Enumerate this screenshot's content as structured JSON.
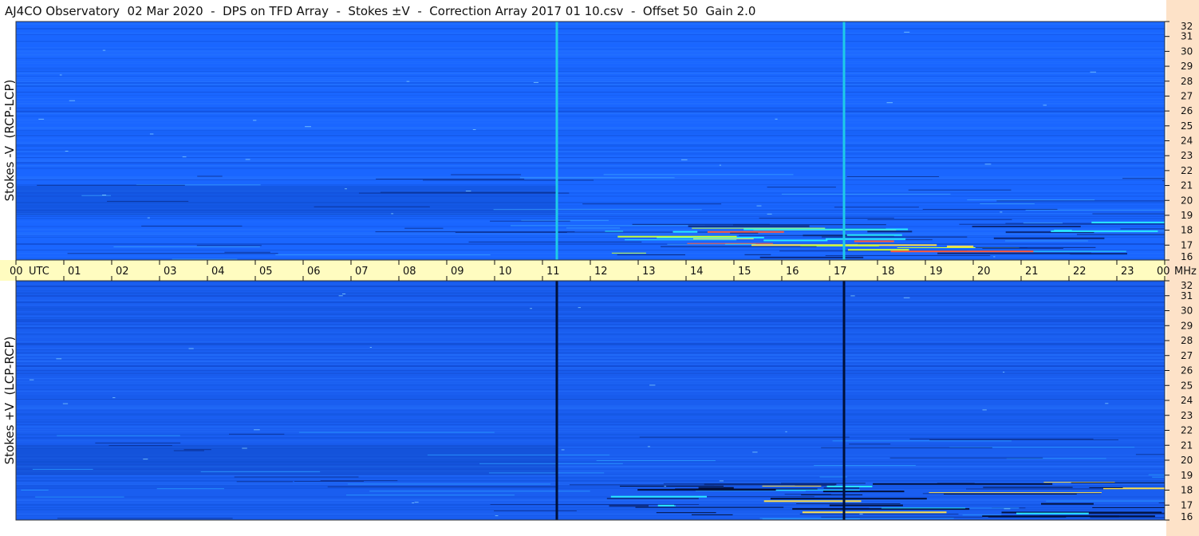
{
  "title": "AJ4CO Observatory  02 Mar 2020  -  DPS on TFD Array  -  Stokes ±V  -  Correction Array 2017 01 10.csv  -  Offset 50  Gain 2.0",
  "colors": {
    "background_top": "#1a66ff",
    "background_bottom": "#1a5ef0",
    "utc_bar": "#fffcc0",
    "right_strip": "#fde2c8",
    "interference_top": "#1ecbe8",
    "interference_bottom": "#00103a"
  },
  "chart_data": [
    {
      "type": "heatmap",
      "panel": "top",
      "ylabel": "Stokes -V  (RCP-LCP)",
      "yticks": [
        "32",
        "31",
        "30",
        "29",
        "28",
        "27",
        "26",
        "25",
        "24",
        "23",
        "22",
        "21",
        "20",
        "19",
        "18",
        "17",
        "16"
      ],
      "ylim": [
        16,
        32
      ],
      "xlim": [
        0,
        24
      ],
      "vertical_lines_utc": [
        11.3,
        17.3
      ],
      "emission_region": {
        "utc_start": 11.0,
        "utc_end": 24.0,
        "freq_mhz": [
          16,
          18
        ]
      }
    },
    {
      "type": "heatmap",
      "panel": "bottom",
      "ylabel": "Stokes +V  (LCP-RCP)",
      "yticks": [
        "32",
        "31",
        "30",
        "29",
        "28",
        "27",
        "26",
        "25",
        "24",
        "23",
        "22",
        "21",
        "20",
        "19",
        "18",
        "17",
        "16"
      ],
      "ylim": [
        16,
        32
      ],
      "xlim": [
        0,
        24
      ],
      "vertical_lines_utc": [
        11.3,
        17.3
      ],
      "emission_region": {
        "utc_start": 11.0,
        "utc_end": 24.0,
        "freq_mhz": [
          16,
          18
        ]
      }
    }
  ],
  "x_axis": {
    "ticks": [
      "00",
      "01",
      "02",
      "03",
      "04",
      "05",
      "06",
      "07",
      "08",
      "09",
      "10",
      "11",
      "12",
      "13",
      "14",
      "15",
      "16",
      "17",
      "18",
      "19",
      "20",
      "21",
      "22",
      "23",
      "00"
    ],
    "start_label": "UTC",
    "end_label": "MHz"
  }
}
